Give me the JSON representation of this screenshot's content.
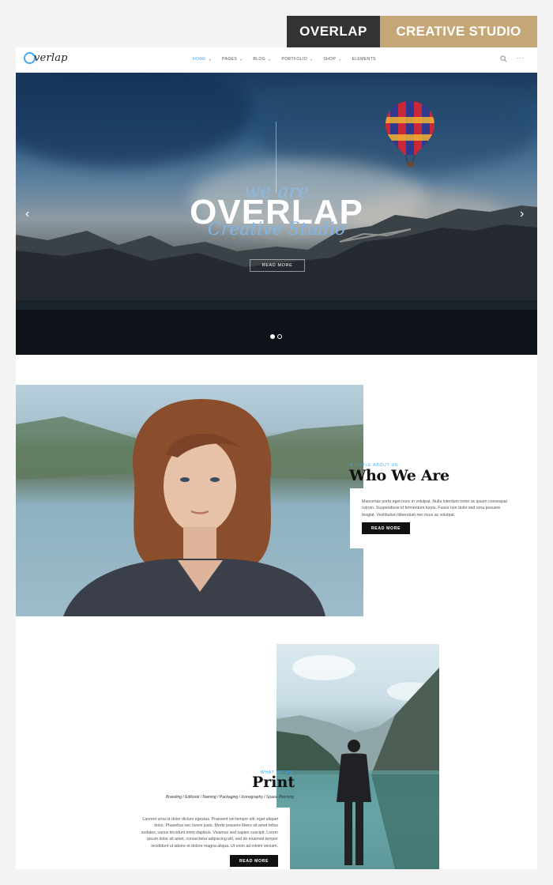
{
  "badge": {
    "left": "OVERLAP",
    "right": "CREATIVE STUDIO"
  },
  "nav": {
    "logo": "verlap",
    "items": [
      {
        "label": "HOME",
        "active": true
      },
      {
        "label": "PAGES",
        "active": false
      },
      {
        "label": "BLOG",
        "active": false
      },
      {
        "label": "PORTFOLIO",
        "active": false
      },
      {
        "label": "SHOP",
        "active": false
      },
      {
        "label": "ELEMENTS",
        "active": false
      }
    ],
    "more": "···"
  },
  "hero": {
    "kicker": "we are",
    "title": "OVERLAP",
    "subtitle": "Creative Studio",
    "button": "READ MORE",
    "prev": "‹",
    "next": "›"
  },
  "about": {
    "eyebrow": "A LITTLE ABOUT US",
    "title": "Who We Are",
    "text": "Maecenas porta eget nunc in volutpat. Nulla interdum tortor ac ipsum consequat rutrum. Suspendisse id fermentum turpis. Fusce non dolor sed urna posuere feugiat. Vestibulum bibendum nec risus ac volutpat.",
    "button": "READ MORE"
  },
  "print": {
    "eyebrow": "WHAT WE DO",
    "title": "Print",
    "tags": "Branding / Editorial / Naming / Packaging / Iconography / Space Planning",
    "text": "Laoreet urna ut dolor dictum egestas. Praesent vel tempor elit, eget aliquet dolor. Phasellus nec lorem justo. Morbi posuere libero sit amet tellus sodales, varius tincidunt enim dapibus. Vivamus sed sapien suscipit. Lorem ipsum dolor sit amet, consectetur adipiscing elit, sed do eiusmod tempor incididunt ut labore et dolore magna aliqua. Ut enim ad minim veniam.",
    "button": "READ MORE"
  },
  "colors": {
    "accent": "#3fa9f5",
    "gold": "#c5a676",
    "dark": "#333333"
  }
}
